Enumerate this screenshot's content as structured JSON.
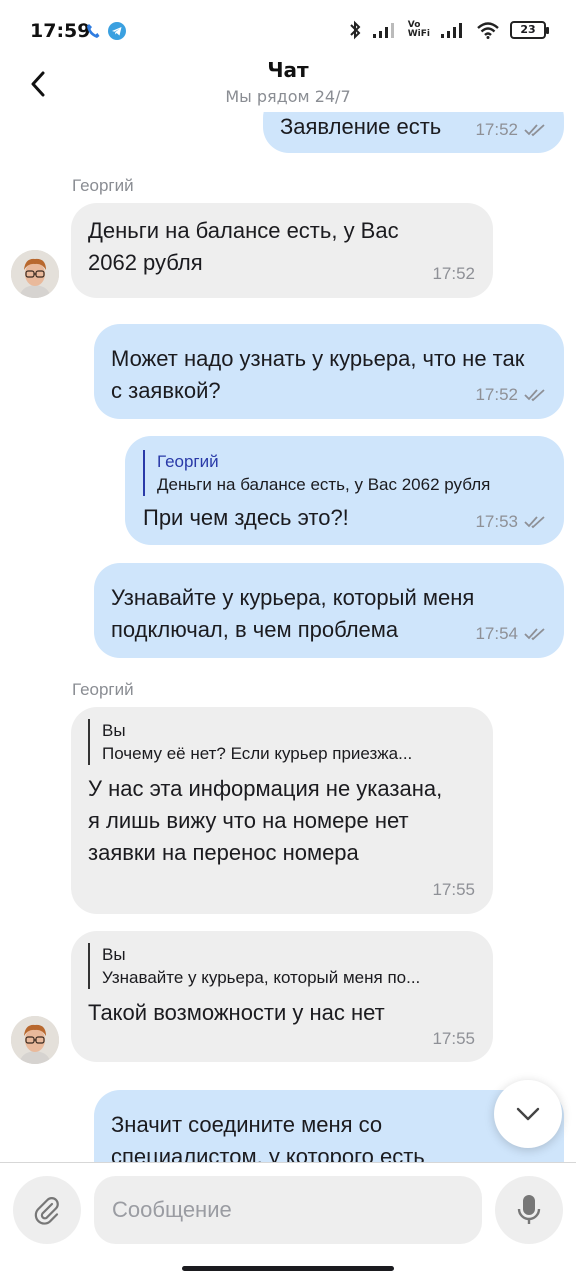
{
  "status_bar": {
    "time": "17:59",
    "battery": "23",
    "vowifi_top": "Vo",
    "vowifi_bottom": "WiFi"
  },
  "header": {
    "title": "Чат",
    "subtitle": "Мы рядом 24/7"
  },
  "messages": [
    {
      "direction": "out",
      "text": "Заявление есть",
      "time": "17:52",
      "status": "read"
    },
    {
      "direction": "in",
      "sender": "Георгий",
      "text": "Деньги на балансе есть, у Вас 2062 рубля",
      "time": "17:52"
    },
    {
      "direction": "out",
      "text": "Может надо узнать у курьера, что не так с заявкой?",
      "time": "17:52",
      "status": "read"
    },
    {
      "direction": "out",
      "reply": {
        "author": "Георгий",
        "text": "Деньги на балансе есть, у Вас 2062 рубля"
      },
      "text": "При чем здесь это?!",
      "time": "17:53",
      "status": "read"
    },
    {
      "direction": "out",
      "text": "Узнавайте у курьера, который меня подключал, в чем проблема",
      "time": "17:54",
      "status": "read"
    },
    {
      "direction": "in",
      "sender": "Георгий",
      "reply": {
        "author": "Вы",
        "text": "Почему её нет? Если курьер приезжа..."
      },
      "text": "У нас эта информация не указана, я лишь вижу что на номере нет заявки на перенос номера",
      "time": "17:55"
    },
    {
      "direction": "in",
      "reply": {
        "author": "Вы",
        "text": "Узнавайте у курьера, который меня по..."
      },
      "text": "Такой возможности у нас нет",
      "time": "17:55"
    },
    {
      "direction": "out",
      "text": "Значит соедините меня со специалистом, у которого есть"
    }
  ],
  "composer": {
    "placeholder": "Сообщение"
  },
  "colors": {
    "outgoing_bubble": "#cfe5fb",
    "incoming_bubble": "#eeeeee",
    "reply_author_out": "#2a3aa8"
  },
  "icons": {
    "back": "chevron-left-icon",
    "attach": "paperclip-icon",
    "mic": "microphone-icon",
    "scroll": "chevron-down-icon",
    "read": "double-check-icon"
  }
}
